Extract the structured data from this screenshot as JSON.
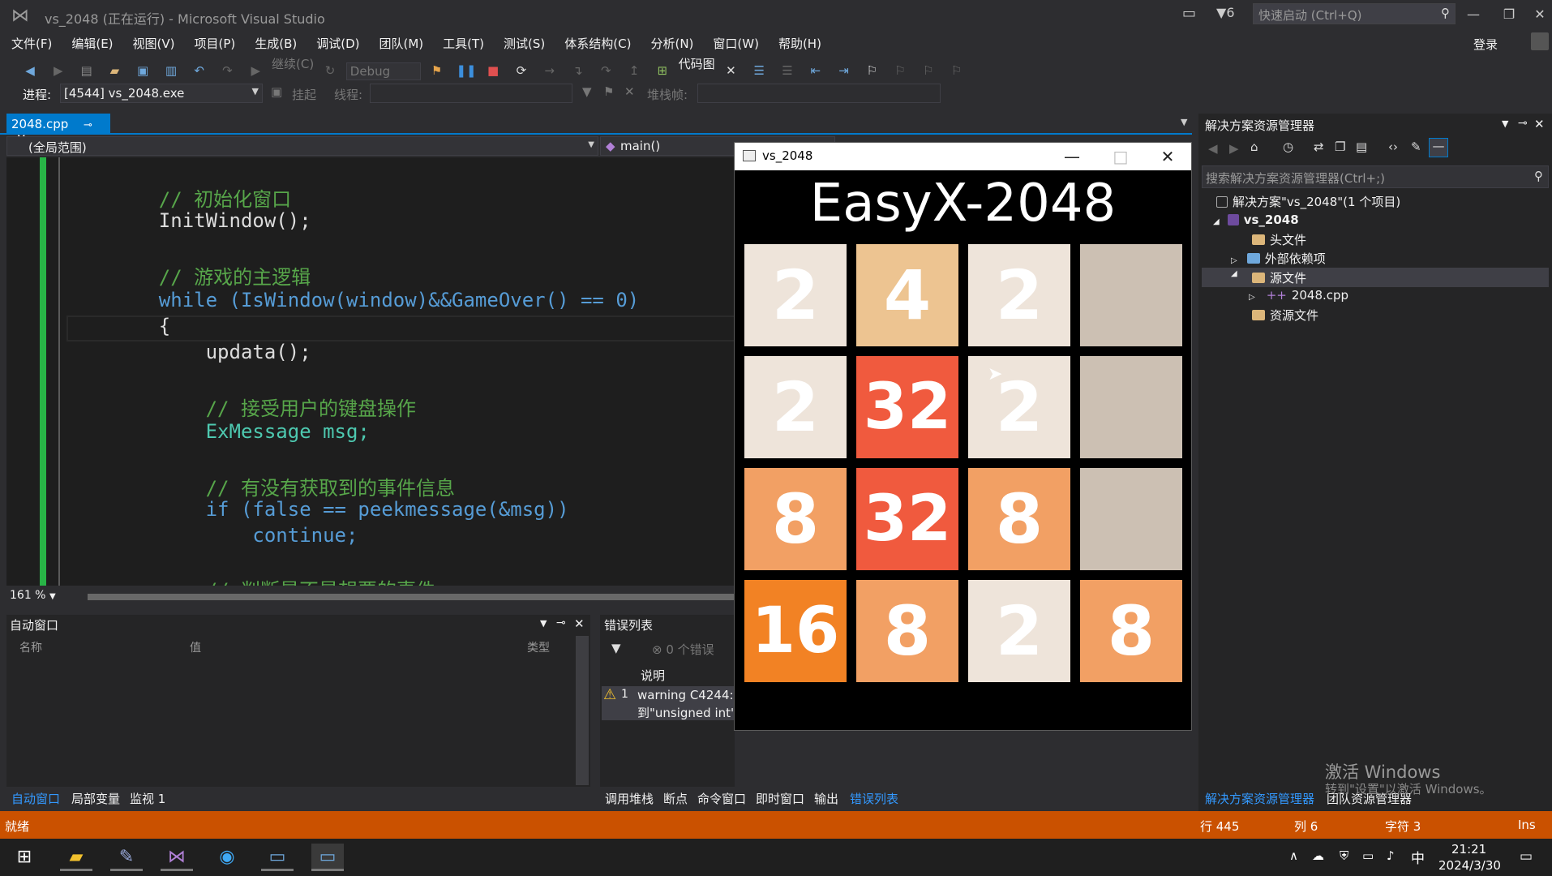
{
  "window": {
    "title": "vs_2048 (正在运行) - Microsoft Visual Studio",
    "notifications": "6",
    "quick_launch_placeholder": "快速启动 (Ctrl+Q)",
    "login": "登录"
  },
  "menu": [
    "文件(F)",
    "编辑(E)",
    "视图(V)",
    "项目(P)",
    "生成(B)",
    "调试(D)",
    "团队(M)",
    "工具(T)",
    "测试(S)",
    "体系结构(C)",
    "分析(N)",
    "窗口(W)",
    "帮助(H)"
  ],
  "toolbar": {
    "continue_label": "继续(C)",
    "config": "Debug",
    "code_map_label": "代码图"
  },
  "toolbar2": {
    "process_label": "进程:",
    "process_value": "[4544] vs_2048.exe",
    "suspend_label": "挂起",
    "thread_label": "线程:",
    "stackframe_label": "堆栈帧:"
  },
  "editor": {
    "tab_name": "2048.cpp",
    "scope": "(全局范围)",
    "function": "main()",
    "zoom": "161 %",
    "lines": [
      "    // 初始化窗口",
      "    InitWindow();",
      "",
      "    // 游戏的主逻辑",
      "    while (IsWindow(window)&&GameOver() == 0)",
      "    {",
      "        updata();",
      "",
      "        // 接受用户的键盘操作",
      "        ExMessage msg;",
      "",
      "        // 有没有获取到的事件信息",
      "        if (false == peekmessage(&msg))",
      "            continue;",
      "",
      "        // 判断是不是想要的事件"
    ]
  },
  "auto_window": {
    "title": "自动窗口",
    "col_name": "名称",
    "col_value": "值",
    "col_type": "类型",
    "tabs": [
      "自动窗口",
      "局部变量",
      "监视 1"
    ]
  },
  "error_list": {
    "title": "错误列表",
    "errors_count": "0 个错误",
    "col_desc": "说明",
    "row_index": "1",
    "warning_line1": "warning C4244: '",
    "warning_line2": "到\"unsigned int\"",
    "tabs": [
      "调用堆栈",
      "断点",
      "命令窗口",
      "即时窗口",
      "输出",
      "错误列表"
    ]
  },
  "solution_explorer": {
    "title": "解决方案资源管理器",
    "search_placeholder": "搜索解决方案资源管理器(Ctrl+;)",
    "solution": "解决方案\"vs_2048\"(1 个项目)",
    "project": "vs_2048",
    "header_files": "头文件",
    "external_deps": "外部依赖项",
    "source_files": "源文件",
    "source_file_1": "2048.cpp",
    "resource_files": "资源文件",
    "tabs": [
      "解决方案资源管理器",
      "团队资源管理器"
    ]
  },
  "watermark": {
    "line1": "激活 Windows",
    "line2": "转到\"设置\"以激活 Windows。"
  },
  "status": {
    "ready": "就绪",
    "line": "行 445",
    "col": "列 6",
    "char": "字符 3",
    "mode": "Ins"
  },
  "game": {
    "window_title": "vs_2048",
    "heading": "EasyX-2048",
    "grid": [
      [
        "2",
        "4",
        "2",
        ""
      ],
      [
        "2",
        "32",
        "2",
        ""
      ],
      [
        "8",
        "32",
        "8",
        ""
      ],
      [
        "16",
        "8",
        "2",
        "8"
      ]
    ],
    "colors": {
      "2": "#eee4da",
      "4": "#edc491",
      "8": "#f2a064",
      "16": "#f28224",
      "32": "#f05a3e",
      "empty": "#ccc0b3"
    }
  },
  "taskbar": {
    "ime": "中",
    "time": "21:21",
    "date": "2024/3/30"
  }
}
